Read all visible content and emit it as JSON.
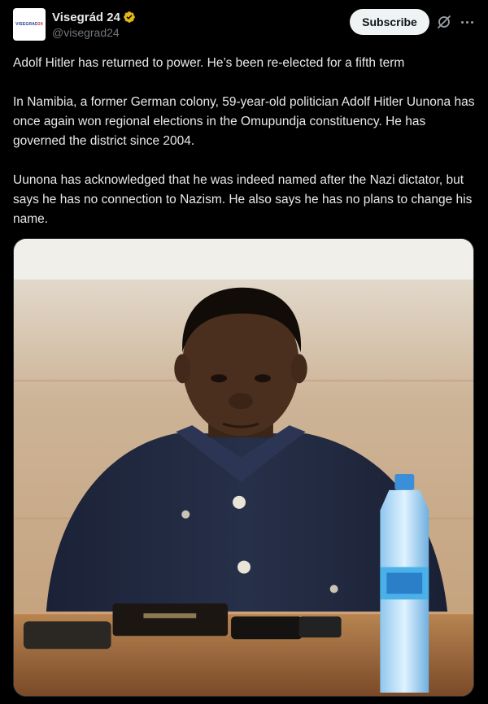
{
  "author": {
    "display_name": "Visegrád 24",
    "handle": "@visegrad24",
    "avatar_text_main": "VISEGRAD",
    "avatar_text_accent": "24",
    "verified": true
  },
  "actions": {
    "subscribe_label": "Subscribe",
    "grok_icon": "grok-icon",
    "more_icon": "more-icon"
  },
  "tweet": {
    "paragraphs": [
      "Adolf Hitler has returned to power. He’s been re-elected for a fifth term",
      "In Namibia, a former German colony, 59-year-old politician Adolf Hitler Uunona has once again won regional elections in the Omupundja constituency. He has governed the district since 2004.",
      "Uunona has acknowledged that he was indeed named after the Nazi dictator, but says he has no connection to Nazism. He also says he has no plans to change his name."
    ]
  },
  "colors": {
    "background": "#000000",
    "text": "#e7e9ea",
    "muted": "#71767b",
    "verified_badge": "#e2b719",
    "subscribe_bg": "#eff3f4"
  }
}
